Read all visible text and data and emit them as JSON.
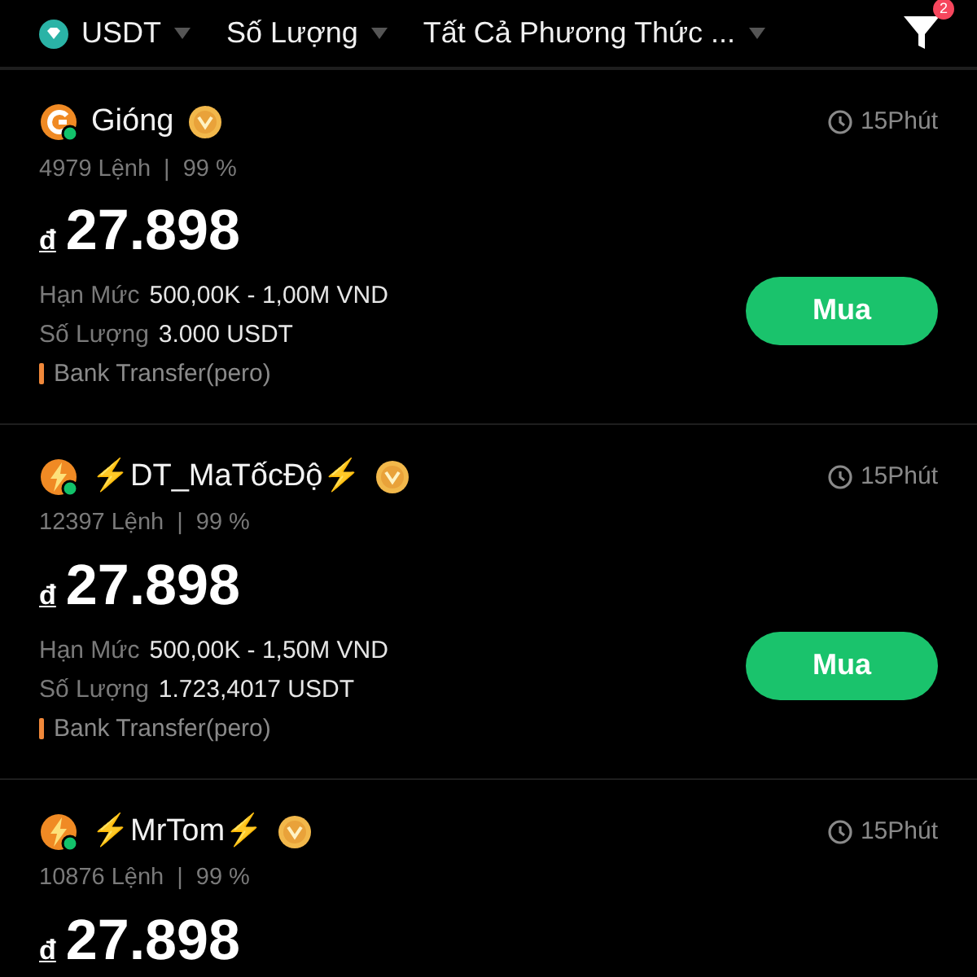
{
  "header": {
    "filters": [
      {
        "label": "USDT",
        "kind": "coin"
      },
      {
        "label": "Số Lượng",
        "kind": "plain"
      },
      {
        "label": "Tất Cả Phương Thức ...",
        "kind": "plain"
      }
    ],
    "filter_badge": "2"
  },
  "offers": [
    {
      "name": "Gióng",
      "kind": "letter",
      "separator": "|",
      "online": true,
      "verified": true,
      "orders": "4979 Lệnh",
      "completion": "99 %",
      "time": "15Phút",
      "currency": "đ",
      "price": "27.898",
      "limit_label": "Hạn Mức",
      "limit": "500,00K - 1,00M VND",
      "qty_label": "Số Lượng",
      "qty": "3.000 USDT",
      "payment": "Bank Transfer(pero)",
      "button": "Mua"
    },
    {
      "name": "⚡DT_MaTốcĐộ⚡",
      "kind": "bolt",
      "separator": "|",
      "online": true,
      "verified": true,
      "orders": "12397 Lệnh",
      "completion": "99 %",
      "time": "15Phút",
      "currency": "đ",
      "price": "27.898",
      "limit_label": "Hạn Mức",
      "limit": "500,00K - 1,50M VND",
      "qty_label": "Số Lượng",
      "qty": "1.723,4017 USDT",
      "payment": "Bank Transfer(pero)",
      "button": "Mua"
    },
    {
      "name": "⚡MrTom⚡",
      "kind": "bolt",
      "separator": "|",
      "online": true,
      "verified": true,
      "orders": "10876 Lệnh",
      "completion": "99 %",
      "time": "15Phút",
      "currency": "đ",
      "price": "27.898"
    }
  ]
}
